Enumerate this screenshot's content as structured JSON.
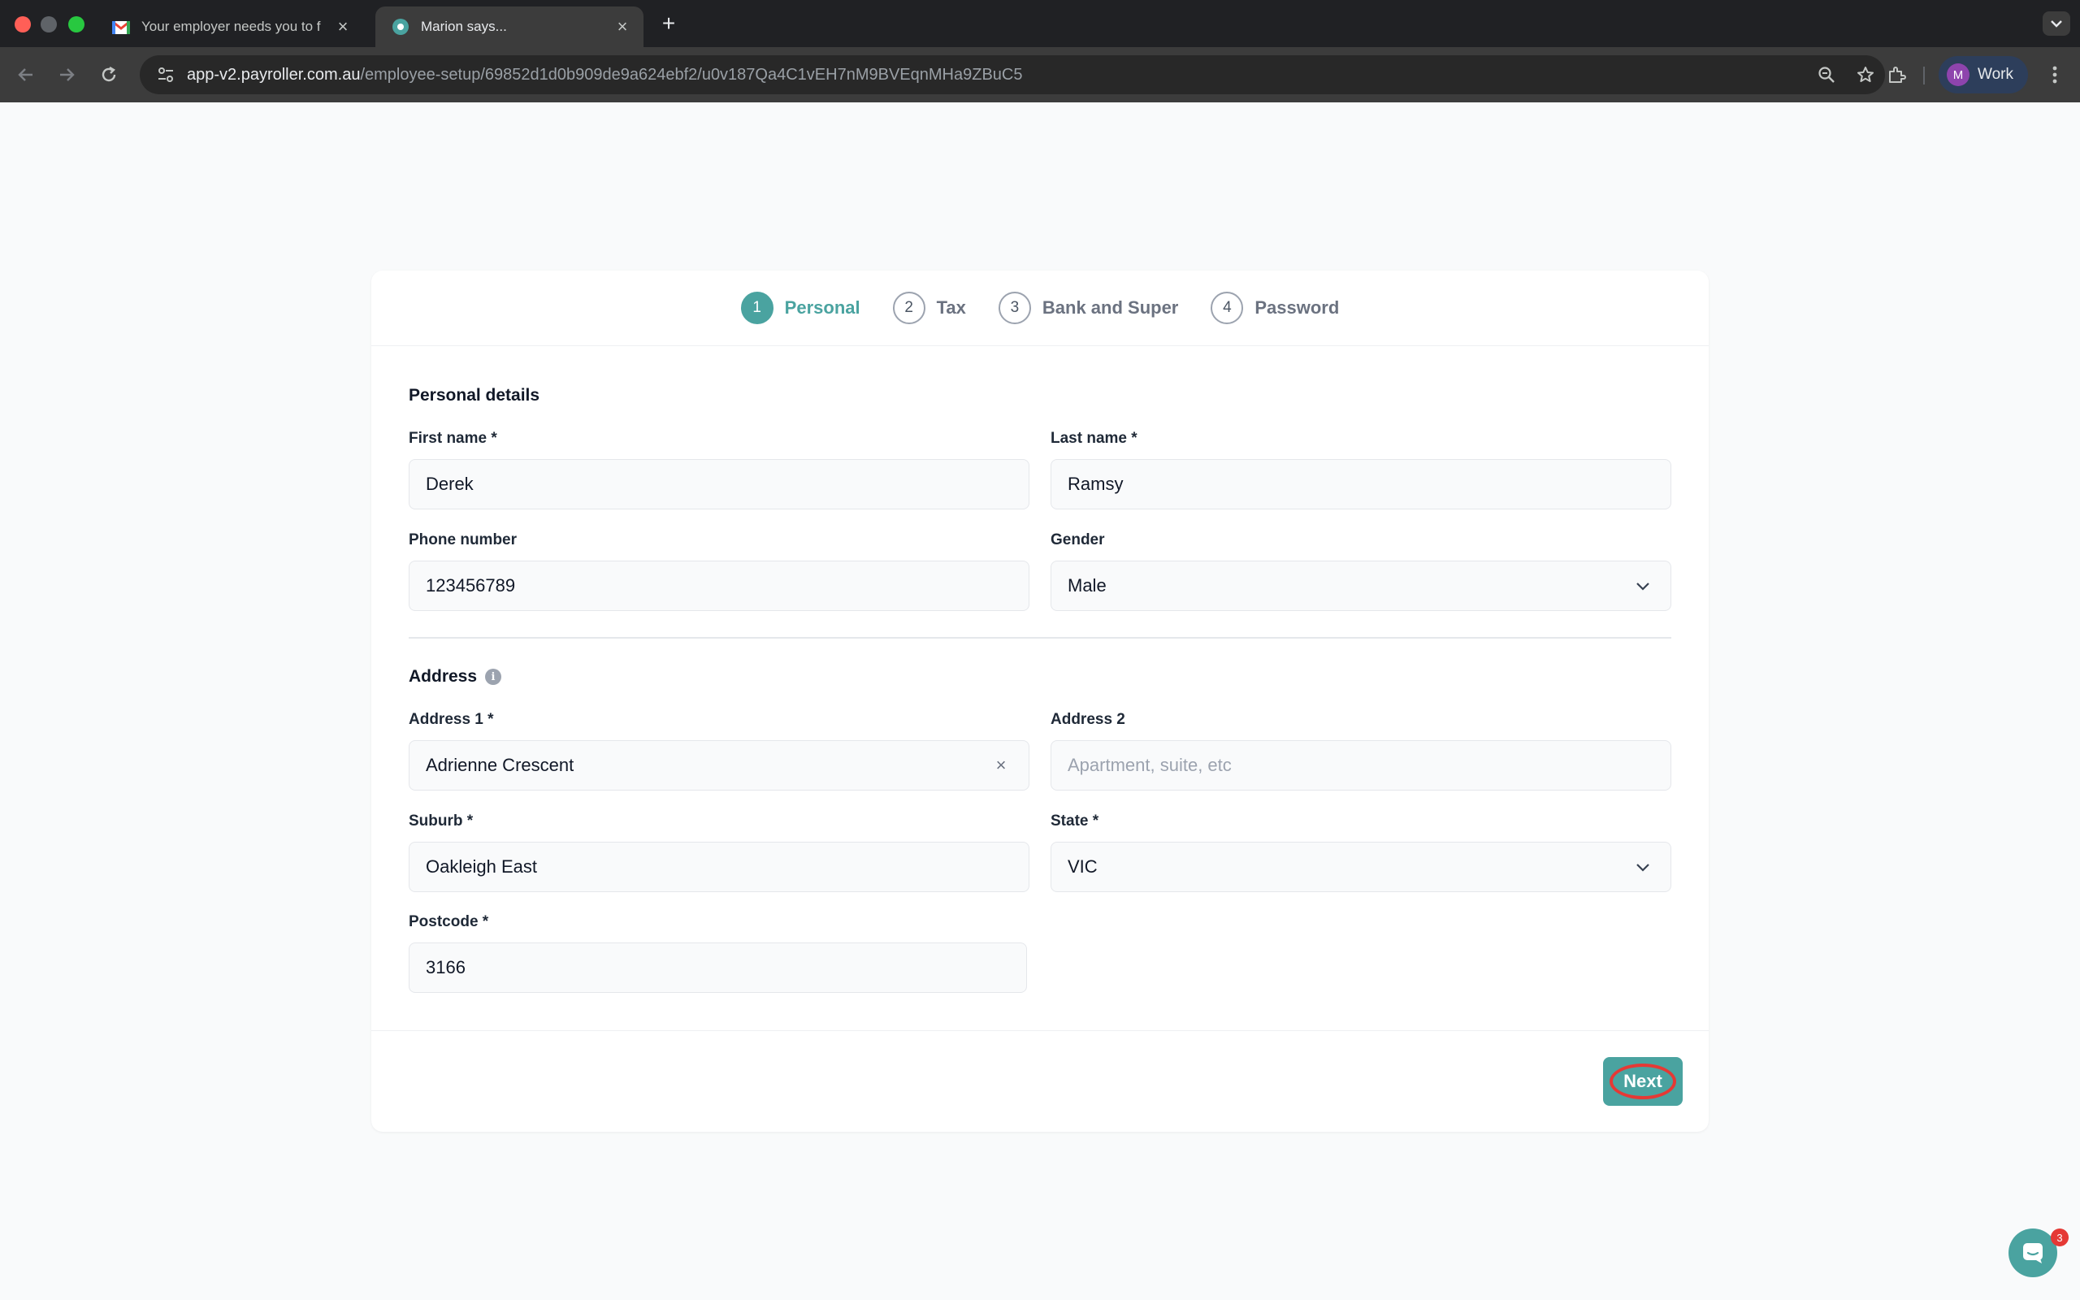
{
  "browser": {
    "tabs": [
      {
        "title": "Your employer needs you to f",
        "favicon": "gmail-icon",
        "active": false
      },
      {
        "title": "Marion says...",
        "favicon": "payroller-icon",
        "active": true
      }
    ],
    "url_host": "app-v2.payroller.com.au",
    "url_path": "/employee-setup/69852d1d0b909de9a624ebf2/u0v187Qa4C1vEH7nM9BVEqnMHa9ZBuC5",
    "profile_initial": "M",
    "profile_name": "Work"
  },
  "stepper": [
    {
      "num": "1",
      "label": "Personal",
      "active": true
    },
    {
      "num": "2",
      "label": "Tax",
      "active": false
    },
    {
      "num": "3",
      "label": "Bank and Super",
      "active": false
    },
    {
      "num": "4",
      "label": "Password",
      "active": false
    }
  ],
  "personal": {
    "title": "Personal details",
    "first_name_label": "First name *",
    "first_name_value": "Derek",
    "last_name_label": "Last name *",
    "last_name_value": "Ramsy",
    "phone_label": "Phone number",
    "phone_value": "123456789",
    "gender_label": "Gender",
    "gender_value": "Male"
  },
  "address": {
    "title": "Address",
    "address1_label": "Address 1 *",
    "address1_value": "Adrienne Crescent",
    "address2_label": "Address 2",
    "address2_placeholder": "Apartment, suite, etc",
    "suburb_label": "Suburb *",
    "suburb_value": "Oakleigh East",
    "state_label": "State *",
    "state_value": "VIC",
    "postcode_label": "Postcode *",
    "postcode_value": "3166"
  },
  "actions": {
    "next_label": "Next"
  },
  "chat": {
    "badge_count": "3"
  },
  "colors": {
    "accent": "#4aa3a0",
    "highlight": "#e53935"
  }
}
